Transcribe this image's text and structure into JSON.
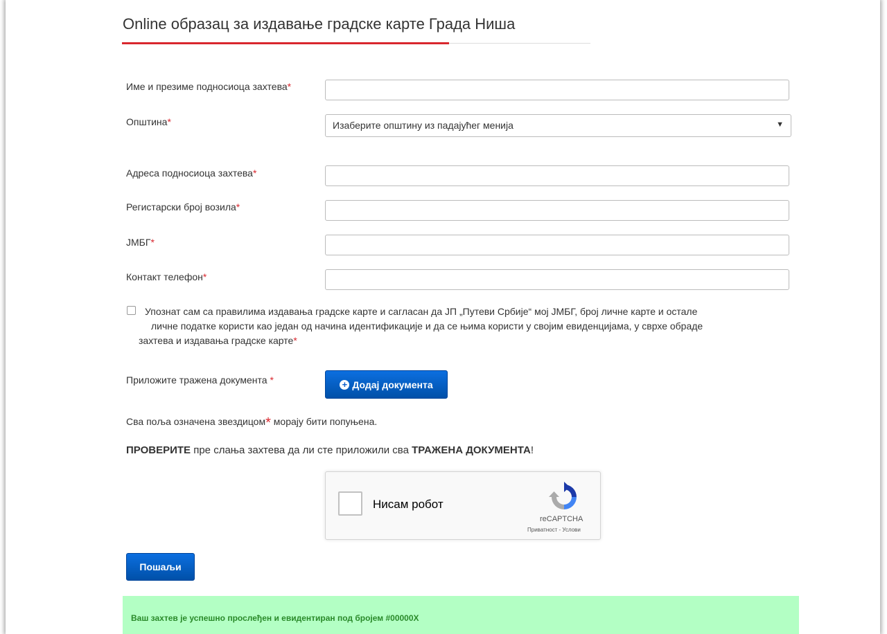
{
  "title": "Online образац за издавање градске карте Града Ниша",
  "fields": [
    {
      "label": "Име и презиме подносиоца захтева",
      "value": ""
    },
    {
      "label": "Адреса подносиоца захтева",
      "value": ""
    },
    {
      "label": "Регистарски број возила",
      "value": ""
    },
    {
      "label": "ЈМБГ",
      "value": ""
    },
    {
      "label": "Контакт телефон",
      "value": ""
    }
  ],
  "municipality": {
    "label": "Општина",
    "selected": "Изаберите општину из падајућег менија"
  },
  "required_mark": "*",
  "consent": {
    "line1": "Упознат сам са правилима издавања градске карте и сагласан да ЈП „Путеви Србије“ мој ЈМБГ, број личне карте и остале",
    "line2": "личне податке користи као један од начина идентификације и да се њима користи у својим евиденцијама, у сврхе обраде",
    "line3": "захтева и издавања градске карте",
    "checked": false
  },
  "documents": {
    "label": "Приложите тражена документа ",
    "button_label": "Додај документа"
  },
  "note": {
    "before": "Сва поља означена звездицом",
    "after": " морају бити попуњена."
  },
  "warning": {
    "bold1": "ПРОВЕРИТЕ",
    "middle": " пре слања захтева да ли сте приложили сва ",
    "bold2": "ТРАЖЕНА ДОКУМЕНТА",
    "end": "!"
  },
  "captcha": {
    "label": "Нисам робот",
    "brand": "reCAPTCHA",
    "links": "Приватност - Услови"
  },
  "submit_label": "Пошаљи",
  "success_message": "Ваш захтев је успешно прослеђен и евидентиран под бројем #00000X",
  "colors": {
    "accent_red": "#d9272e",
    "button_blue": "#0050a8",
    "success_bg": "#b3ffc4",
    "success_text": "#2a8a2a"
  }
}
